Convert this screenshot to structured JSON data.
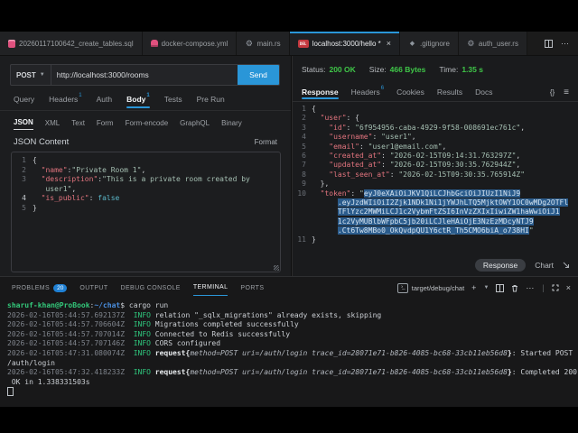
{
  "colors": {
    "accent_blue": "#2a96d8",
    "success_green": "#3fc648",
    "badge_blue": "#1f80d4",
    "selection_blue": "#2b5c8c",
    "key_red": "#e2747e",
    "string_teal": "#a5bfb2",
    "bool_cyan": "#5bb8c9",
    "prompt_green": "#33c87a",
    "path_blue": "#4a8ede",
    "info_green": "#2fc77d",
    "icon_pink": "#e0517e",
    "rest_icon_red": "#c4383f"
  },
  "editor_tabs": {
    "items": [
      {
        "icon": "db",
        "label": "20260117100642_create_tables.sql"
      },
      {
        "icon": "docker",
        "label": "docker-compose.yml"
      },
      {
        "icon": "gear",
        "label": "main.rs"
      },
      {
        "icon": "rest",
        "icon_text": "DEL",
        "label": "localhost:3000/hello *",
        "cls": "active",
        "close": "×"
      },
      {
        "icon": "diamond",
        "label": ".gitignore"
      },
      {
        "icon": "gear",
        "label": "auth_user.rs"
      }
    ]
  },
  "request": {
    "method": "POST",
    "url": "http://localhost:3000/rooms",
    "send_label": "Send"
  },
  "request_tabs": [
    {
      "label": "Query"
    },
    {
      "label": "Headers",
      "count": "1"
    },
    {
      "label": "Auth"
    },
    {
      "label": "Body",
      "count": "1",
      "cls": "active"
    },
    {
      "label": "Tests"
    },
    {
      "label": "Pre Run"
    }
  ],
  "body_type_tabs": [
    {
      "label": "JSON",
      "cls": "active"
    },
    {
      "label": "XML"
    },
    {
      "label": "Text"
    },
    {
      "label": "Form"
    },
    {
      "label": "Form-encode"
    },
    {
      "label": "GraphQL"
    },
    {
      "label": "Binary"
    }
  ],
  "body_editor": {
    "label": "JSON Content",
    "format_label": "Format",
    "lines": [
      {
        "n": "1",
        "parts": [
          [
            "p",
            "{"
          ]
        ]
      },
      {
        "n": "2",
        "parts": [
          [
            "p",
            "  "
          ],
          [
            "k",
            "\"name\""
          ],
          [
            "p",
            ":"
          ],
          [
            "s",
            "\"Private Room 1\""
          ],
          [
            "p",
            ","
          ]
        ]
      },
      {
        "n": "3",
        "parts": [
          [
            "p",
            "  "
          ],
          [
            "k",
            "\"description\""
          ],
          [
            "p",
            ":"
          ],
          [
            "s",
            "\"This is a private room created by"
          ]
        ]
      },
      {
        "parts": [
          [
            "s",
            "   user1\""
          ],
          [
            "p",
            ","
          ]
        ]
      },
      {
        "n": "4",
        "nc": "cur-ln",
        "parts": [
          [
            "p",
            "  "
          ],
          [
            "k",
            "\"is_public\""
          ],
          [
            "p",
            ": "
          ],
          [
            "b",
            "false"
          ]
        ]
      },
      {
        "n": "5",
        "parts": [
          [
            "p",
            "}"
          ]
        ]
      }
    ]
  },
  "response": {
    "status": {
      "status_label": "Status:",
      "status_value": "200 OK",
      "size_label": "Size:",
      "size_value": "466 Bytes",
      "time_label": "Time:",
      "time_value": "1.35 s"
    },
    "tabs": [
      {
        "label": "Response",
        "cls": "active"
      },
      {
        "label": "Headers",
        "count": "6"
      },
      {
        "label": "Cookies"
      },
      {
        "label": "Results"
      },
      {
        "label": "Docs"
      }
    ],
    "format_icon": "{}",
    "menu_icon": "≡",
    "lines": [
      {
        "n": "1",
        "parts": [
          [
            "p",
            "{"
          ]
        ]
      },
      {
        "n": "2",
        "parts": [
          [
            "p",
            "  "
          ],
          [
            "k",
            "\"user\""
          ],
          [
            "p",
            ": {"
          ]
        ]
      },
      {
        "n": "3",
        "parts": [
          [
            "p",
            "    "
          ],
          [
            "k",
            "\"id\""
          ],
          [
            "p",
            ": "
          ],
          [
            "s",
            "\"6f954956-caba-4929-9f58-008691ec761c\""
          ],
          [
            "p",
            ","
          ]
        ]
      },
      {
        "n": "4",
        "parts": [
          [
            "p",
            "    "
          ],
          [
            "k",
            "\"username\""
          ],
          [
            "p",
            ": "
          ],
          [
            "s",
            "\"user1\""
          ],
          [
            "p",
            ","
          ]
        ]
      },
      {
        "n": "5",
        "parts": [
          [
            "p",
            "    "
          ],
          [
            "k",
            "\"email\""
          ],
          [
            "p",
            ": "
          ],
          [
            "s",
            "\"user1@email.com\""
          ],
          [
            "p",
            ","
          ]
        ]
      },
      {
        "n": "6",
        "parts": [
          [
            "p",
            "    "
          ],
          [
            "k",
            "\"created_at\""
          ],
          [
            "p",
            ": "
          ],
          [
            "s",
            "\"2026-02-15T09:14:31.763297Z\""
          ],
          [
            "p",
            ","
          ]
        ]
      },
      {
        "n": "7",
        "parts": [
          [
            "p",
            "    "
          ],
          [
            "k",
            "\"updated_at\""
          ],
          [
            "p",
            ": "
          ],
          [
            "s",
            "\"2026-02-15T09:30:35.762944Z\""
          ],
          [
            "p",
            ","
          ]
        ]
      },
      {
        "n": "8",
        "parts": [
          [
            "p",
            "    "
          ],
          [
            "k",
            "\"last_seen_at\""
          ],
          [
            "p",
            ": "
          ],
          [
            "s",
            "\"2026-02-15T09:30:35.765914Z\""
          ]
        ]
      },
      {
        "n": "9",
        "parts": [
          [
            "p",
            "  },"
          ]
        ]
      },
      {
        "n": "10",
        "parts": [
          [
            "p",
            "  "
          ],
          [
            "k",
            "\"token\""
          ],
          [
            "p",
            ": "
          ],
          [
            "s",
            "\""
          ],
          [
            "sel",
            "eyJ0eXAiOiJKV1QiLCJhbGciOiJIUzI1NiJ9"
          ]
        ]
      },
      {
        "parts": [
          [
            "p",
            "      "
          ],
          [
            "sel",
            ".eyJzdWIiOiI2Zjk1NDk1Ni1jYWJhLTQ5MjktOWY1OC0wMDg2OTFl"
          ]
        ]
      },
      {
        "parts": [
          [
            "p",
            "      "
          ],
          [
            "sel",
            "TFlYzc2MWMiLCJ1c2VybmFtZSI6InVzZXIxIiwiZW1haWwiOiJ1"
          ]
        ]
      },
      {
        "parts": [
          [
            "p",
            "      "
          ],
          [
            "sel",
            "1c2VyMUBlbWFpbC5jb20iLCJleHAiOjE3NzEzMDcyNTJ9"
          ]
        ]
      },
      {
        "parts": [
          [
            "p",
            "      "
          ],
          [
            "sel",
            ".Ct6Tw8MBo0_OkQvdpQU1Y6ctR_Th5CMO6biA_o738HI"
          ],
          [
            "s",
            "\""
          ]
        ]
      },
      {
        "n": "11",
        "parts": [
          [
            "p",
            "}"
          ]
        ]
      }
    ],
    "overlay": {
      "response_label": "Response",
      "chart_label": "Chart"
    }
  },
  "panel": {
    "tabs": [
      {
        "label": "PROBLEMS",
        "badge": "20"
      },
      {
        "label": "OUTPUT"
      },
      {
        "label": "DEBUG CONSOLE"
      },
      {
        "label": "TERMINAL",
        "cls": "active"
      },
      {
        "label": "PORTS"
      }
    ],
    "toolbar": {
      "terminal_label": "target/debug/chat"
    }
  },
  "terminal": {
    "lines": [
      {
        "parts": [
          [
            "tg",
            "sharuf-khan@ProBook"
          ],
          [
            "tw",
            ":"
          ],
          [
            "tb",
            "~/chat"
          ],
          [
            "tw",
            "$ cargo run"
          ]
        ]
      },
      {
        "parts": [
          [
            "ts",
            "2026-02-16T05:44:57.692137Z"
          ],
          [
            "tw",
            "  "
          ],
          [
            "ti",
            "INFO"
          ],
          [
            "tw",
            " relation \"_sqlx_migrations\" already exists, skipping"
          ]
        ]
      },
      {
        "parts": [
          [
            "ts",
            "2026-02-16T05:44:57.706604Z"
          ],
          [
            "tw",
            "  "
          ],
          [
            "ti",
            "INFO"
          ],
          [
            "tw",
            " Migrations completed successfully"
          ]
        ]
      },
      {
        "parts": [
          [
            "ts",
            "2026-02-16T05:44:57.707014Z"
          ],
          [
            "tw",
            "  "
          ],
          [
            "ti",
            "INFO"
          ],
          [
            "tw",
            " Connected to Redis successfully"
          ]
        ]
      },
      {
        "parts": [
          [
            "ts",
            "2026-02-16T05:44:57.707146Z"
          ],
          [
            "tw",
            "  "
          ],
          [
            "ti",
            "INFO"
          ],
          [
            "tw",
            " CORS configured"
          ]
        ]
      },
      {
        "parts": [
          [
            "ts",
            "2026-02-16T05:47:31.080074Z"
          ],
          [
            "tw",
            "  "
          ],
          [
            "ti",
            "INFO"
          ],
          [
            "tbd",
            " request{"
          ],
          [
            "tit",
            "method=POST uri=/auth/login trace_id=28071e71-b826-4085-bc68-33cb11eb56d8"
          ],
          [
            "tbd",
            "}"
          ],
          [
            "tw",
            ": Started POST"
          ]
        ]
      },
      {
        "parts": [
          [
            "tw",
            "/auth/login"
          ]
        ]
      },
      {
        "parts": [
          [
            "ts",
            "2026-02-16T05:47:32.418233Z"
          ],
          [
            "tw",
            "  "
          ],
          [
            "ti",
            "INFO"
          ],
          [
            "tbd",
            " request{"
          ],
          [
            "tit",
            "method=POST uri=/auth/login trace_id=28071e71-b826-4085-bc68-33cb11eb56d8"
          ],
          [
            "tbd",
            "}"
          ],
          [
            "tw",
            ": Completed 200"
          ]
        ]
      },
      {
        "parts": [
          [
            "tw",
            " OK in 1.338331503s"
          ]
        ]
      },
      {
        "parts": [
          [
            "cur",
            " "
          ]
        ]
      }
    ]
  }
}
